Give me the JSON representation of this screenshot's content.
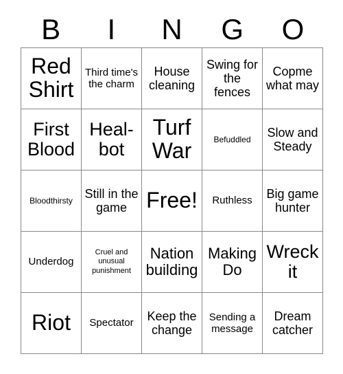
{
  "card": {
    "type": "bingo-card",
    "title_letters": [
      "B",
      "I",
      "N",
      "G",
      "O"
    ],
    "rows": 5,
    "columns": 5,
    "free_space": "Free!",
    "colors": {
      "background": "#ffffff",
      "text": "#000000",
      "grid_line": "#888888"
    },
    "cells": [
      [
        {
          "text": "Red Shirt",
          "size": "xxl"
        },
        {
          "text": "Third time's the charm",
          "size": "sm"
        },
        {
          "text": "House cleaning",
          "size": "md"
        },
        {
          "text": "Swing for the fences",
          "size": "md"
        },
        {
          "text": "Copme what may",
          "size": "md"
        }
      ],
      [
        {
          "text": "First Blood",
          "size": "xl"
        },
        {
          "text": "Heal-bot",
          "size": "xl"
        },
        {
          "text": "Turf War",
          "size": "xxl"
        },
        {
          "text": "Befuddled",
          "size": "xs"
        },
        {
          "text": "Slow and Steady",
          "size": "md"
        }
      ],
      [
        {
          "text": "Bloodthirsty",
          "size": "xs"
        },
        {
          "text": "Still in the game",
          "size": "md"
        },
        {
          "text": "Free!",
          "size": "xxl"
        },
        {
          "text": "Ruthless",
          "size": "sm"
        },
        {
          "text": "Big game hunter",
          "size": "md"
        }
      ],
      [
        {
          "text": "Underdog",
          "size": "sm"
        },
        {
          "text": "Cruel and unusual punishment",
          "size": "xxs"
        },
        {
          "text": "Nation building",
          "size": "lg"
        },
        {
          "text": "Making Do",
          "size": "lg"
        },
        {
          "text": "Wreck it",
          "size": "xl"
        }
      ],
      [
        {
          "text": "Riot",
          "size": "xxl"
        },
        {
          "text": "Spectator",
          "size": "sm"
        },
        {
          "text": "Keep the change",
          "size": "md"
        },
        {
          "text": "Sending a message",
          "size": "sm"
        },
        {
          "text": "Dream catcher",
          "size": "md"
        }
      ]
    ]
  }
}
